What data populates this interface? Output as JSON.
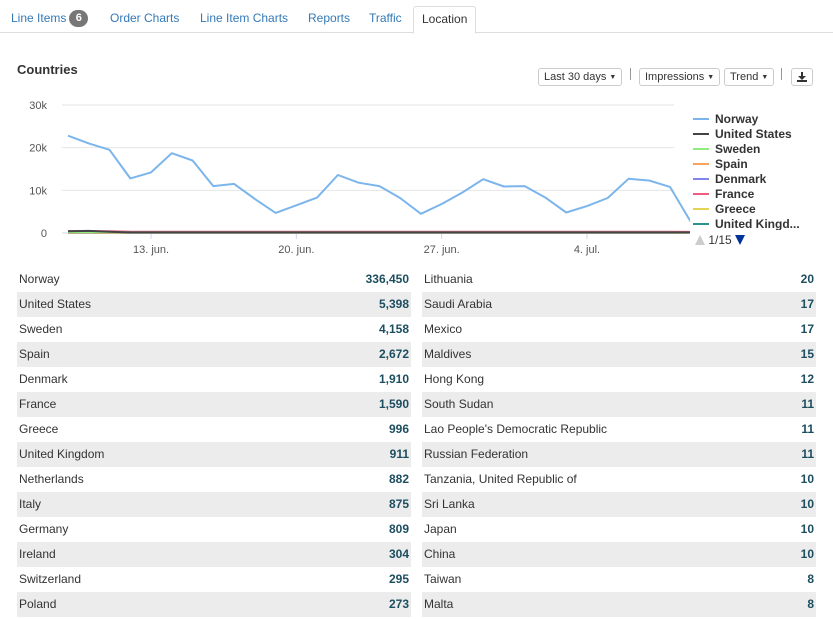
{
  "tabs": [
    {
      "label": "Line Items",
      "badge": "6"
    },
    {
      "label": "Order Charts"
    },
    {
      "label": "Line Item Charts"
    },
    {
      "label": "Reports"
    },
    {
      "label": "Traffic"
    },
    {
      "label": "Location"
    }
  ],
  "active_tab": "Location",
  "panel": {
    "title": "Countries",
    "range_label": "Last 30 days",
    "metric_label": "Impressions",
    "mode_label": "Trend",
    "download_icon": "download-icon"
  },
  "chart_data": {
    "type": "line",
    "ylim": [
      0,
      30000
    ],
    "y_ticks": [
      0,
      10000,
      20000,
      30000
    ],
    "y_tick_labels": [
      "0",
      "10k",
      "20k",
      "30k"
    ],
    "x_ticks": [
      "2019-06-13",
      "2019-06-20",
      "2019-06-27",
      "2019-07-04"
    ],
    "x_tick_labels": [
      "13. jun.",
      "20. jun.",
      "27. jun.",
      "4. jul."
    ],
    "x": [
      "2019-06-09",
      "2019-06-10",
      "2019-06-11",
      "2019-06-12",
      "2019-06-13",
      "2019-06-14",
      "2019-06-15",
      "2019-06-16",
      "2019-06-17",
      "2019-06-18",
      "2019-06-19",
      "2019-06-20",
      "2019-06-21",
      "2019-06-22",
      "2019-06-23",
      "2019-06-24",
      "2019-06-25",
      "2019-06-26",
      "2019-06-27",
      "2019-06-28",
      "2019-06-29",
      "2019-06-30",
      "2019-07-01",
      "2019-07-02",
      "2019-07-03",
      "2019-07-04",
      "2019-07-05",
      "2019-07-06",
      "2019-07-07",
      "2019-07-08"
    ],
    "grid": true,
    "legend_position": "right",
    "series": [
      {
        "name": "Norway",
        "color": "#7cb5ec",
        "values": [
          22800,
          21000,
          19500,
          12800,
          14200,
          18700,
          17000,
          11000,
          11500,
          8000,
          4700,
          6500,
          8300,
          13600,
          11800,
          11000,
          8200,
          4500,
          6800,
          9500,
          12600,
          10900,
          11000,
          8300,
          4800,
          6300,
          8200,
          12700,
          12300,
          10800,
          2600
        ]
      },
      {
        "name": "United States",
        "color": "#434348",
        "values": [
          400,
          500,
          300,
          150,
          150,
          150,
          150,
          150,
          150,
          150,
          150,
          150,
          150,
          150,
          150,
          150,
          150,
          150,
          150,
          150,
          150,
          150,
          150,
          150,
          150,
          150,
          150,
          150,
          150,
          150,
          150
        ]
      },
      {
        "name": "Sweden",
        "color": "#90ed7d",
        "values": [
          200,
          200,
          200,
          150,
          150,
          150,
          150,
          130,
          130,
          130,
          130,
          130,
          130,
          130,
          130,
          130,
          130,
          130,
          130,
          130,
          130,
          130,
          130,
          130,
          130,
          130,
          130,
          130,
          130,
          130,
          100
        ]
      },
      {
        "name": "Spain",
        "color": "#f7a35c",
        "values": [
          120,
          120,
          100,
          90,
          90,
          90,
          90,
          90,
          90,
          90,
          90,
          90,
          90,
          90,
          90,
          90,
          90,
          90,
          90,
          90,
          90,
          90,
          90,
          90,
          90,
          90,
          90,
          90,
          90,
          90,
          80
        ]
      },
      {
        "name": "Denmark",
        "color": "#8085e9",
        "values": [
          80,
          80,
          70,
          60,
          60,
          60,
          60,
          60,
          60,
          60,
          60,
          60,
          60,
          60,
          60,
          60,
          60,
          60,
          60,
          60,
          60,
          60,
          60,
          60,
          60,
          60,
          60,
          60,
          60,
          60,
          50
        ]
      },
      {
        "name": "France",
        "color": "#f15c80",
        "values": [
          450,
          450,
          400,
          300,
          300,
          300,
          300,
          300,
          300,
          300,
          300,
          300,
          300,
          300,
          300,
          300,
          300,
          300,
          300,
          300,
          300,
          300,
          300,
          300,
          300,
          300,
          300,
          300,
          300,
          300,
          250
        ]
      },
      {
        "name": "Greece",
        "color": "#e4d354",
        "values": [
          40,
          40,
          35,
          30,
          30,
          30,
          30,
          30,
          30,
          30,
          30,
          30,
          30,
          30,
          30,
          30,
          30,
          30,
          30,
          30,
          30,
          30,
          30,
          30,
          30,
          30,
          30,
          30,
          30,
          30,
          25
        ]
      },
      {
        "name": "United Kingd...",
        "color": "#2b908f",
        "values": [
          30,
          30,
          30,
          30,
          30,
          30,
          30,
          30,
          30,
          30,
          30,
          30,
          30,
          30,
          30,
          30,
          30,
          30,
          30,
          30,
          30,
          30,
          30,
          30,
          30,
          30,
          30,
          30,
          30,
          30,
          30
        ]
      }
    ]
  },
  "legend_page": "1/15",
  "countries_left": [
    {
      "name": "Norway",
      "value": "336,450"
    },
    {
      "name": "United States",
      "value": "5,398"
    },
    {
      "name": "Sweden",
      "value": "4,158"
    },
    {
      "name": "Spain",
      "value": "2,672"
    },
    {
      "name": "Denmark",
      "value": "1,910"
    },
    {
      "name": "France",
      "value": "1,590"
    },
    {
      "name": "Greece",
      "value": "996"
    },
    {
      "name": "United Kingdom",
      "value": "911"
    },
    {
      "name": "Netherlands",
      "value": "882"
    },
    {
      "name": "Italy",
      "value": "875"
    },
    {
      "name": "Germany",
      "value": "809"
    },
    {
      "name": "Ireland",
      "value": "304"
    },
    {
      "name": "Switzerland",
      "value": "295"
    },
    {
      "name": "Poland",
      "value": "273"
    }
  ],
  "countries_right": [
    {
      "name": "Lithuania",
      "value": "20"
    },
    {
      "name": "Saudi Arabia",
      "value": "17"
    },
    {
      "name": "Mexico",
      "value": "17"
    },
    {
      "name": "Maldives",
      "value": "15"
    },
    {
      "name": "Hong Kong",
      "value": "12"
    },
    {
      "name": "South Sudan",
      "value": "11"
    },
    {
      "name": "Lao People's Democratic Republic",
      "value": "11"
    },
    {
      "name": "Russian Federation",
      "value": "11"
    },
    {
      "name": "Tanzania, United Republic of",
      "value": "10"
    },
    {
      "name": "Sri Lanka",
      "value": "10"
    },
    {
      "name": "Japan",
      "value": "10"
    },
    {
      "name": "China",
      "value": "10"
    },
    {
      "name": "Taiwan",
      "value": "8"
    },
    {
      "name": "Malta",
      "value": "8"
    }
  ]
}
